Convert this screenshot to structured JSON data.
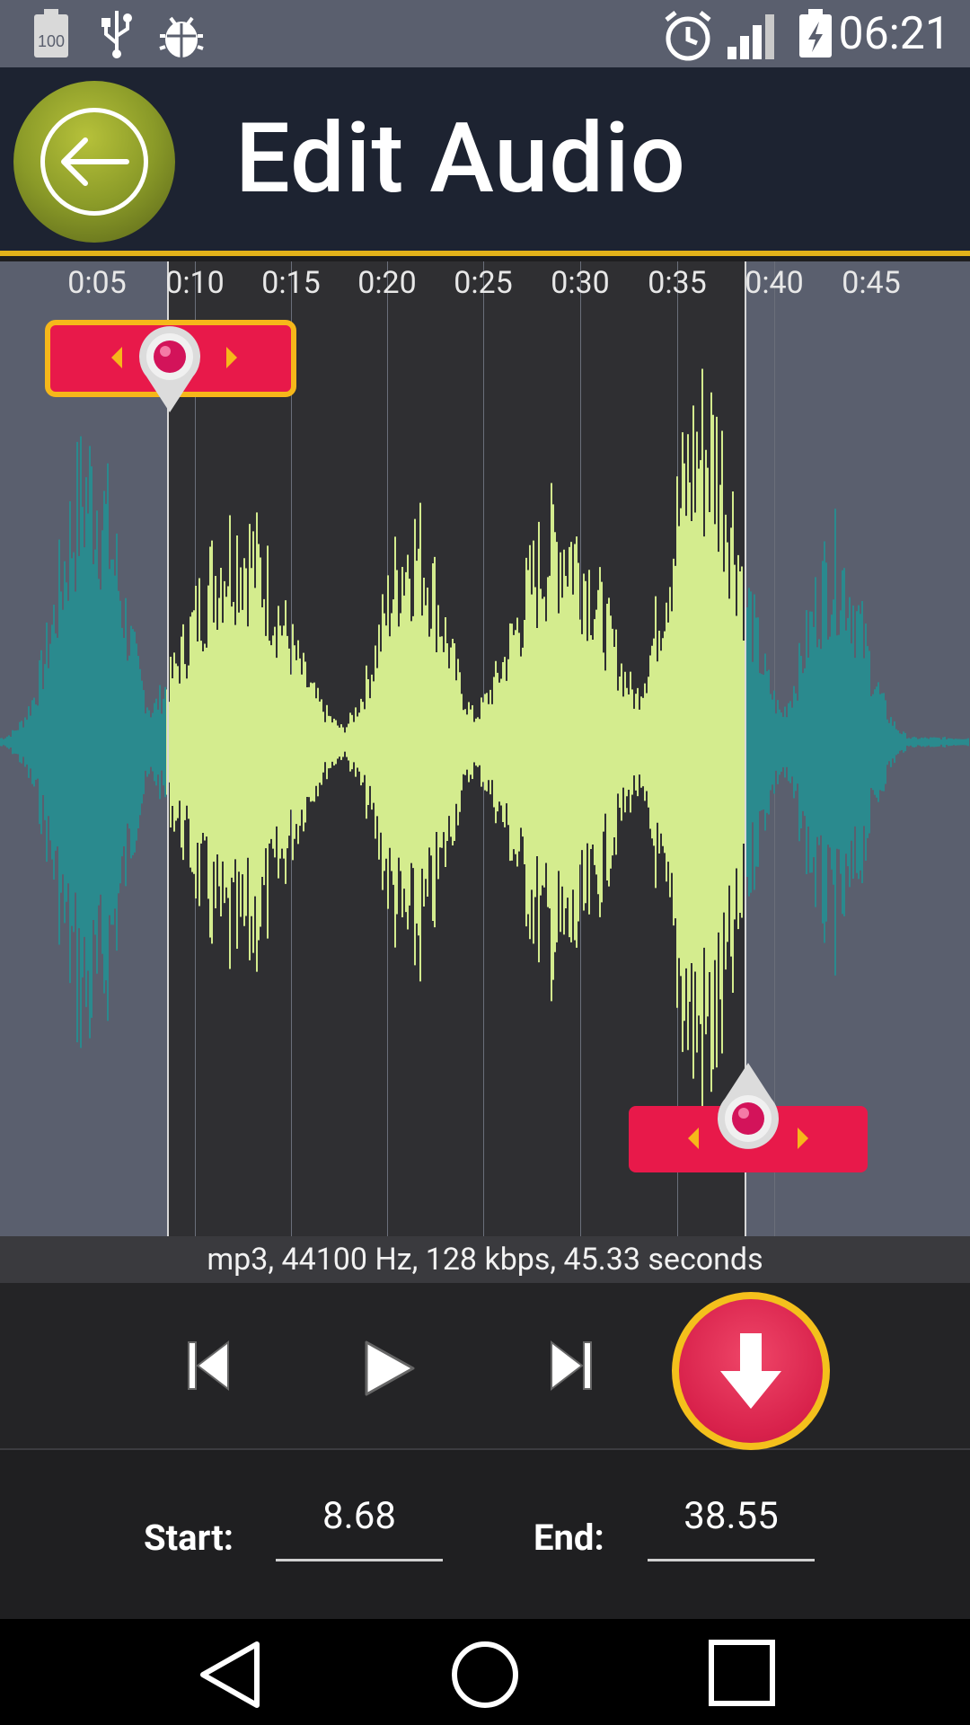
{
  "status_bar": {
    "time": "06:21",
    "battery_level_text": "100",
    "icons": [
      "battery-full-icon",
      "usb-icon",
      "debug-bug-icon",
      "alarm-icon",
      "signal-icon",
      "battery-charging-icon"
    ]
  },
  "header": {
    "title": "Edit Audio",
    "back_icon": "arrow-left-icon"
  },
  "timeline": {
    "ticks": [
      "0:05",
      "0:10",
      "0:15",
      "0:20",
      "0:25",
      "0:30",
      "0:35",
      "0:40",
      "0:45"
    ]
  },
  "waveform": {
    "selection_start_seconds": 8.68,
    "selection_end_seconds": 38.55,
    "colors": {
      "selected": "#d4ec8e",
      "unselected": "#2a8a8e",
      "selection_bg": "#2f2f32",
      "outside_bg": "#5a5f6e",
      "marker": "#e8194a",
      "marker_border": "#f6b71a",
      "header_accent": "#e3b21a"
    }
  },
  "info": {
    "text": "mp3, 44100 Hz, 128 kbps, 45.33 seconds"
  },
  "controls": {
    "prev_icon": "skip-previous-icon",
    "play_icon": "play-icon",
    "next_icon": "skip-next-icon",
    "save_icon": "download-arrow-icon"
  },
  "range": {
    "start_label": "Start:",
    "start_value": "8.68",
    "end_label": "End:",
    "end_value": "38.55"
  },
  "nav_bar": {
    "icons": [
      "nav-back-icon",
      "nav-home-icon",
      "nav-recents-icon"
    ]
  }
}
